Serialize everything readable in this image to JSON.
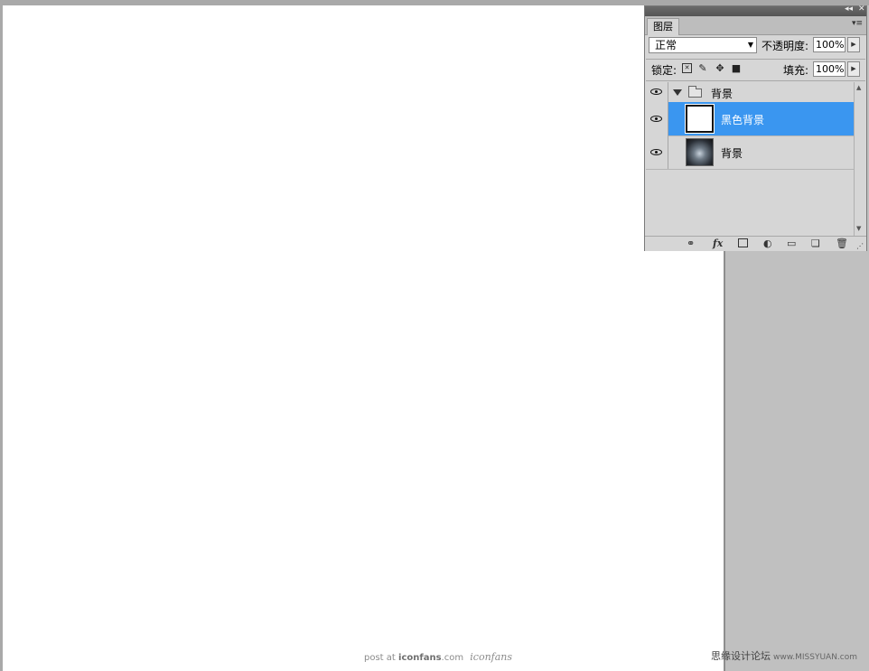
{
  "panel": {
    "title_tab": "图层",
    "blend_mode": "正常",
    "opacity_label": "不透明度:",
    "opacity_value": "100%",
    "lock_label": "锁定:",
    "fill_label": "填充:",
    "fill_value": "100%",
    "lock_icons": [
      "lock-transparent-icon",
      "lock-paint-icon",
      "lock-move-icon",
      "lock-all-icon"
    ],
    "footer_icons": [
      "link-layers-icon",
      "fx-icon",
      "mask-icon",
      "adjustment-icon",
      "new-group-icon",
      "new-layer-icon",
      "trash-icon"
    ]
  },
  "layers": [
    {
      "name": "背景",
      "type": "group",
      "visible": true,
      "selected": false
    },
    {
      "name": "黑色背景",
      "type": "layer",
      "thumb": "white",
      "visible": true,
      "selected": true
    },
    {
      "name": "背景",
      "type": "layer",
      "thumb": "dark",
      "visible": true,
      "selected": false
    }
  ],
  "watermark": {
    "left_prefix": "post at",
    "left_site": "iconfans",
    "left_suffix": ".com",
    "left_logo": "iconfans",
    "right_text": "思缘设计论坛",
    "right_url": "www.MISSYUAN.com"
  },
  "colors": {
    "selection": "#3a96f0",
    "canvas": "#ffffff",
    "workspace": "#c0c0c0"
  }
}
